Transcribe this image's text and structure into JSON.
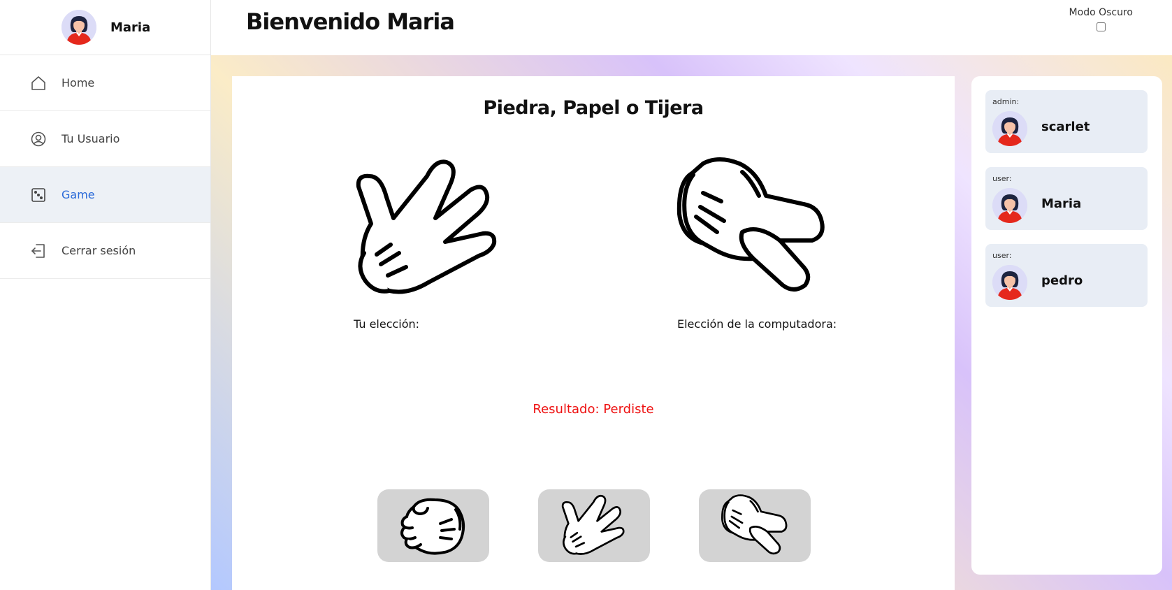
{
  "sidebar": {
    "profile_name": "Maria",
    "items": [
      {
        "label": "Home",
        "icon": "home-icon"
      },
      {
        "label": "Tu Usuario",
        "icon": "user-circle-icon"
      },
      {
        "label": "Game",
        "icon": "dice-icon",
        "active": true
      },
      {
        "label": "Cerrar sesión",
        "icon": "logout-icon"
      }
    ]
  },
  "header": {
    "title": "Bienvenido Maria",
    "dark_mode_label": "Modo Oscuro"
  },
  "game": {
    "title": "Piedra, Papel o Tijera",
    "player_label": "Tu elección:",
    "computer_label": "Elección de la computadora:",
    "result": "Resultado: Perdiste",
    "player_choice": "papel",
    "computer_choice": "tijera",
    "buttons": [
      {
        "name": "piedra",
        "icon": "rock-hand-icon"
      },
      {
        "name": "papel",
        "icon": "paper-hand-icon"
      },
      {
        "name": "tijera",
        "icon": "scissors-hand-icon"
      }
    ]
  },
  "users": [
    {
      "role": "admin:",
      "name": "scarlet"
    },
    {
      "role": "user:",
      "name": "Maria"
    },
    {
      "role": "user:",
      "name": "pedro"
    }
  ],
  "colors": {
    "accent": "#2a6ad8",
    "result": "#e11111",
    "active_nav_bg": "#edf1f6",
    "button_bg": "#d3d3d3",
    "user_card_bg": "#e8edf5"
  }
}
